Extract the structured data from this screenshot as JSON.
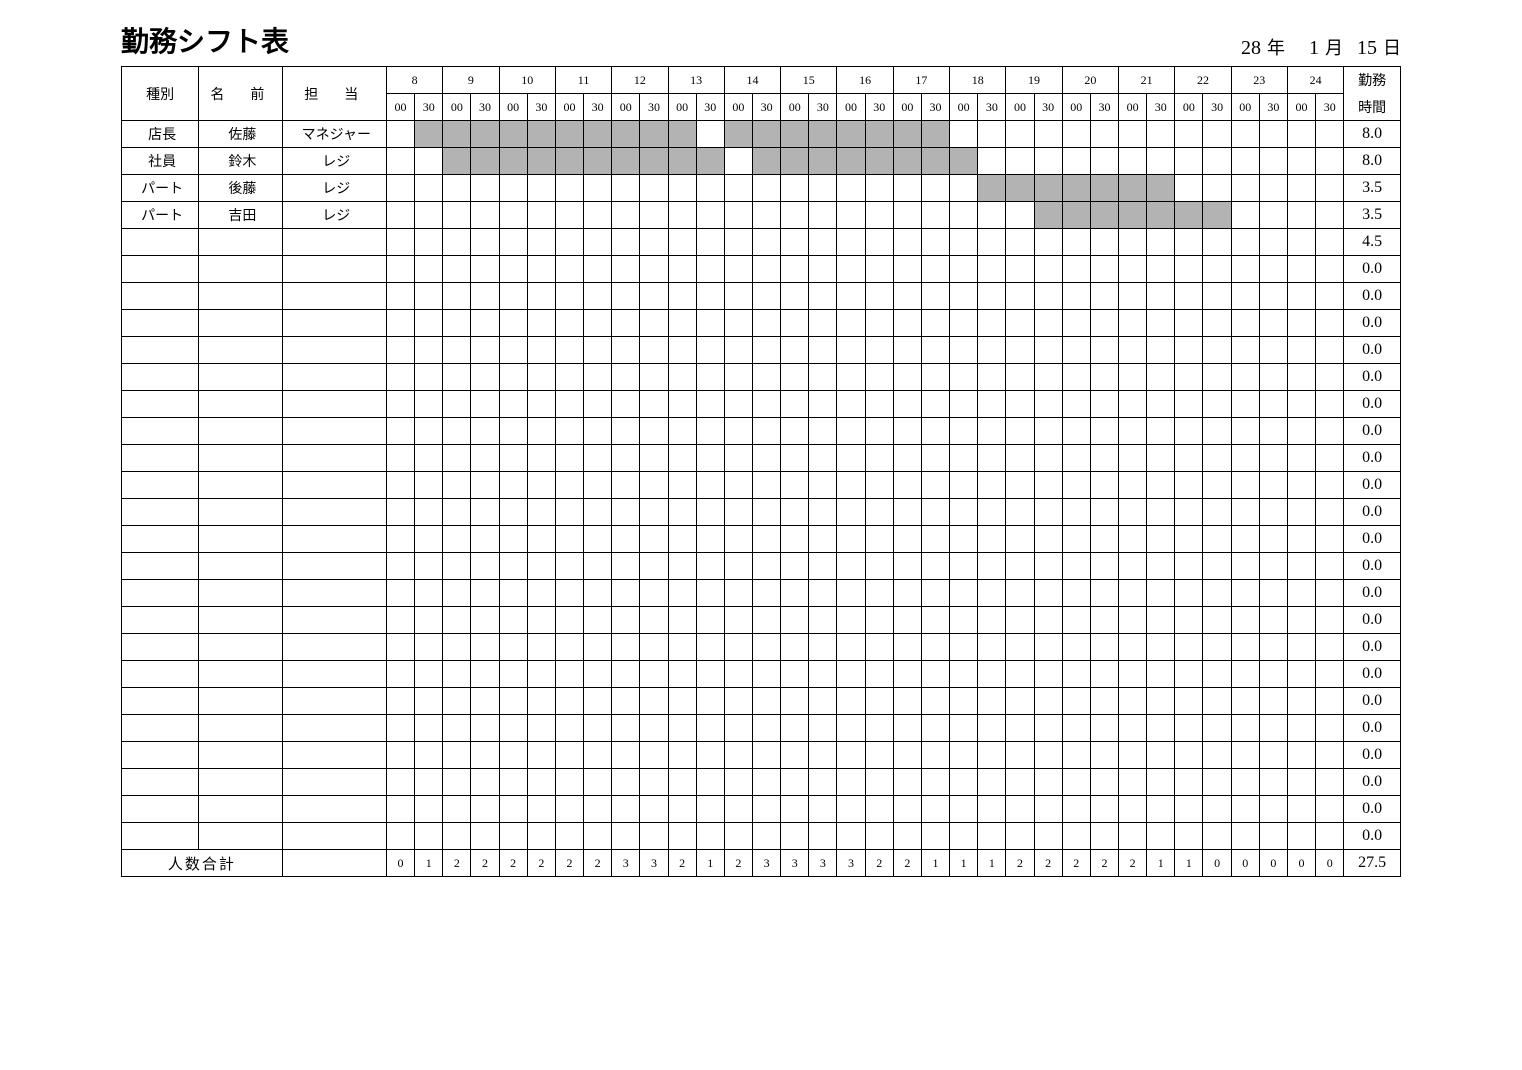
{
  "title": "勤務シフト表",
  "date": {
    "year": "28",
    "year_unit": "年",
    "month": "1",
    "month_unit": "月",
    "day": "15",
    "day_unit": "日"
  },
  "header": {
    "type": "種別",
    "name": "名　前",
    "role": "担　当",
    "hours_line1": "勤務",
    "hours_line2": "時間",
    "hours": [
      8,
      9,
      10,
      11,
      12,
      13,
      14,
      15,
      16,
      17,
      18,
      19,
      20,
      21,
      22,
      23,
      24
    ],
    "subslots": [
      "00",
      "30"
    ]
  },
  "rows": [
    {
      "type": "店長",
      "name": "佐藤",
      "role": "マネジャー",
      "shaded": [
        1,
        2,
        3,
        4,
        5,
        6,
        7,
        8,
        9,
        10,
        12,
        13,
        14,
        15,
        16,
        17,
        18,
        19
      ],
      "hours": "8.0"
    },
    {
      "type": "社員",
      "name": "鈴木",
      "role": "レジ",
      "shaded": [
        2,
        3,
        4,
        5,
        6,
        7,
        8,
        9,
        10,
        11,
        13,
        14,
        15,
        16,
        17,
        18,
        19,
        20
      ],
      "hours": "8.0"
    },
    {
      "type": "パート",
      "name": "後藤",
      "role": "レジ",
      "shaded": [
        21,
        22,
        23,
        24,
        25,
        26,
        27
      ],
      "hours": "3.5"
    },
    {
      "type": "パート",
      "name": "吉田",
      "role": "レジ",
      "shaded": [
        23,
        24,
        25,
        26,
        27,
        28,
        29
      ],
      "hours": "3.5"
    },
    {
      "type": "",
      "name": "",
      "role": "",
      "shaded": [],
      "hours": "4.5"
    },
    {
      "type": "",
      "name": "",
      "role": "",
      "shaded": [],
      "hours": "0.0"
    },
    {
      "type": "",
      "name": "",
      "role": "",
      "shaded": [],
      "hours": "0.0"
    },
    {
      "type": "",
      "name": "",
      "role": "",
      "shaded": [],
      "hours": "0.0"
    },
    {
      "type": "",
      "name": "",
      "role": "",
      "shaded": [],
      "hours": "0.0"
    },
    {
      "type": "",
      "name": "",
      "role": "",
      "shaded": [],
      "hours": "0.0"
    },
    {
      "type": "",
      "name": "",
      "role": "",
      "shaded": [],
      "hours": "0.0"
    },
    {
      "type": "",
      "name": "",
      "role": "",
      "shaded": [],
      "hours": "0.0"
    },
    {
      "type": "",
      "name": "",
      "role": "",
      "shaded": [],
      "hours": "0.0"
    },
    {
      "type": "",
      "name": "",
      "role": "",
      "shaded": [],
      "hours": "0.0"
    },
    {
      "type": "",
      "name": "",
      "role": "",
      "shaded": [],
      "hours": "0.0"
    },
    {
      "type": "",
      "name": "",
      "role": "",
      "shaded": [],
      "hours": "0.0"
    },
    {
      "type": "",
      "name": "",
      "role": "",
      "shaded": [],
      "hours": "0.0"
    },
    {
      "type": "",
      "name": "",
      "role": "",
      "shaded": [],
      "hours": "0.0"
    },
    {
      "type": "",
      "name": "",
      "role": "",
      "shaded": [],
      "hours": "0.0"
    },
    {
      "type": "",
      "name": "",
      "role": "",
      "shaded": [],
      "hours": "0.0"
    },
    {
      "type": "",
      "name": "",
      "role": "",
      "shaded": [],
      "hours": "0.0"
    },
    {
      "type": "",
      "name": "",
      "role": "",
      "shaded": [],
      "hours": "0.0"
    },
    {
      "type": "",
      "name": "",
      "role": "",
      "shaded": [],
      "hours": "0.0"
    },
    {
      "type": "",
      "name": "",
      "role": "",
      "shaded": [],
      "hours": "0.0"
    },
    {
      "type": "",
      "name": "",
      "role": "",
      "shaded": [],
      "hours": "0.0"
    },
    {
      "type": "",
      "name": "",
      "role": "",
      "shaded": [],
      "hours": "0.0"
    },
    {
      "type": "",
      "name": "",
      "role": "",
      "shaded": [],
      "hours": "0.0"
    }
  ],
  "footer": {
    "label": "人数合計",
    "counts": [
      0,
      1,
      2,
      2,
      2,
      2,
      2,
      2,
      3,
      3,
      2,
      1,
      2,
      3,
      3,
      3,
      3,
      2,
      2,
      1,
      1,
      1,
      2,
      2,
      2,
      2,
      2,
      1,
      1,
      0,
      0,
      0,
      0,
      0
    ],
    "total": "27.5"
  }
}
